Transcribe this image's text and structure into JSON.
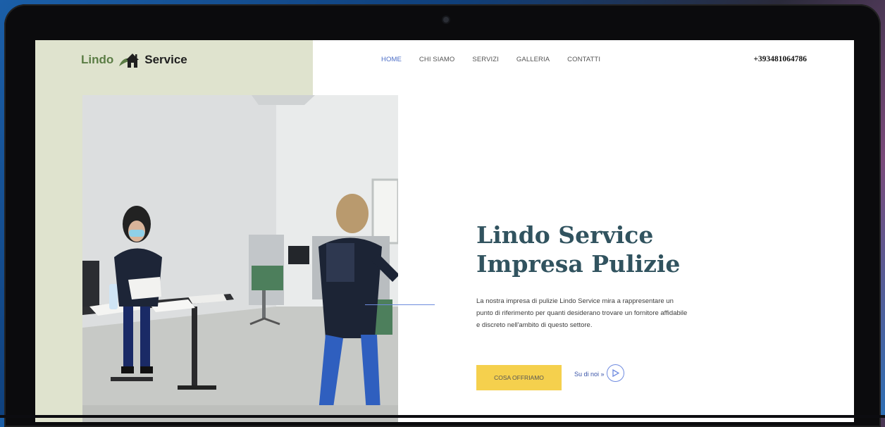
{
  "site": {
    "logo": {
      "word1": "Lindo",
      "word2": "Service"
    },
    "nav": [
      {
        "label": "HOME",
        "active": true
      },
      {
        "label": "CHI SIAMO",
        "active": false
      },
      {
        "label": "SERVIZI",
        "active": false
      },
      {
        "label": "GALLERIA",
        "active": false
      },
      {
        "label": "CONTATTI",
        "active": false
      }
    ],
    "phone": "+393481064786"
  },
  "hero": {
    "title_line1": "Lindo Service",
    "title_line2": "Impresa Pulizie",
    "description": "La nostra impresa di pulizie Lindo Service mira a rappresentare un punto di riferimento per quanti desiderano trovare un fornitore affidabile e discreto nell'ambito di questo settore.",
    "cta_label": "COSA OFFRIAMO",
    "secondary_link": "Su di noi »"
  },
  "colors": {
    "accent_green": "#5b7d45",
    "panel_green": "#dfe3ce",
    "nav_active": "#4a6cc6",
    "title_teal": "#31535f",
    "cta_yellow": "#f5d04d"
  }
}
